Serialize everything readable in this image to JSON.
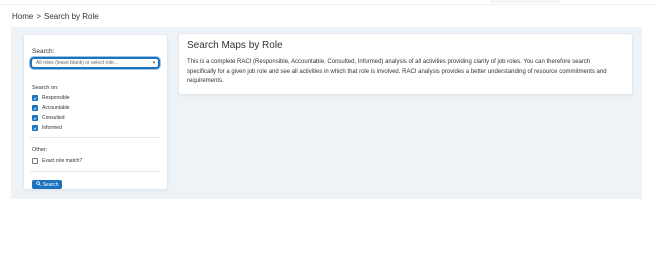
{
  "breadcrumb": {
    "home": "Home",
    "separator": ">",
    "current": "Search by Role"
  },
  "search_panel": {
    "search_label": "Search:",
    "role_select": {
      "placeholder": "All roles (leave blank) or select role..."
    },
    "search_on_label": "Search on:",
    "options": [
      {
        "label": "Responsible",
        "checked": true
      },
      {
        "label": "Accountable",
        "checked": true
      },
      {
        "label": "Consulted",
        "checked": true
      },
      {
        "label": "Informed",
        "checked": true
      }
    ],
    "other_label": "Other:",
    "exact_match": {
      "label": "Exact role match?",
      "checked": false
    },
    "search_button": "Search",
    "search_button_icon": "search-icon"
  },
  "info_panel": {
    "title": "Search Maps by Role",
    "description": "This is a complete RACI (Responsible, Accountable, Consulted, Informed) analysis of all activities providing clarity of job roles. You can therefore search specifically for a given job role and see all activities in which that role is involved. RACI analysis provides a better understanding of resource commitments and requirements."
  },
  "colors": {
    "accent": "#1e73be",
    "background": "#eef3f8"
  }
}
